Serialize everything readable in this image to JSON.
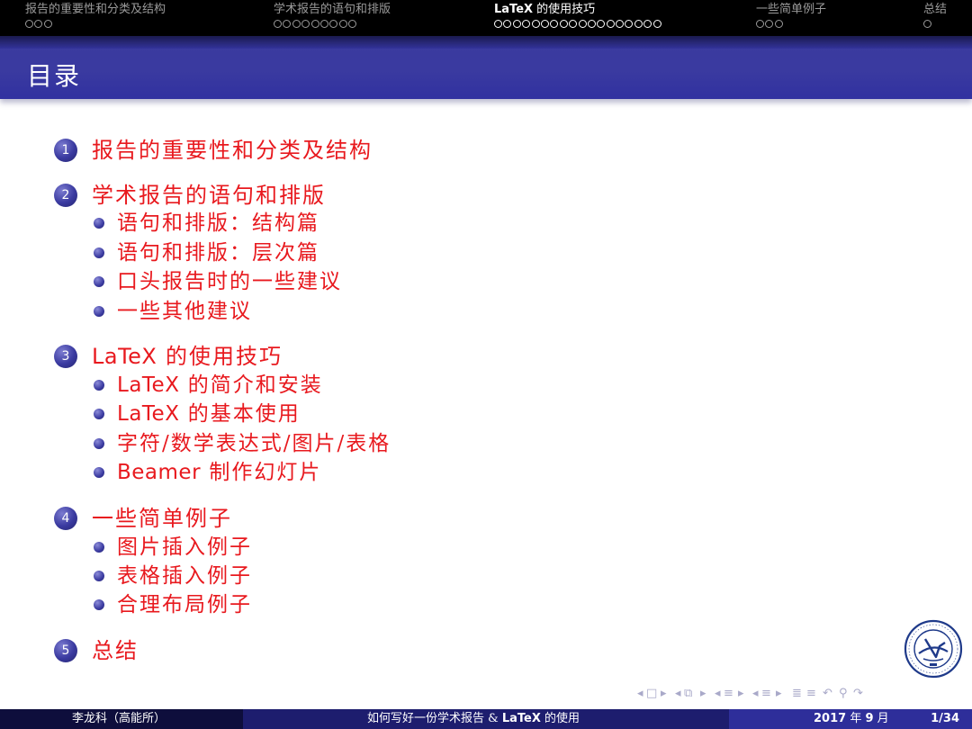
{
  "nav": {
    "sections": [
      {
        "title": "报告的重要性和分类及结构",
        "dots": 3,
        "active": false
      },
      {
        "title": "学术报告的语句和排版",
        "dots": 9,
        "active": false
      },
      {
        "title_latin": "LaTeX",
        "title_rest": " 的使用技巧",
        "dots": 18,
        "active": true
      },
      {
        "title": "一些简单例子",
        "dots": 3,
        "active": false
      },
      {
        "title": "总结",
        "dots": 1,
        "active": false
      }
    ]
  },
  "frame": {
    "title": "目录"
  },
  "toc": {
    "sections": [
      {
        "number": "1",
        "label": "报告的重要性和分类及结构",
        "subs": []
      },
      {
        "number": "2",
        "label": "学术报告的语句和排版",
        "subs": [
          "语句和排版：结构篇",
          "语句和排版：层次篇",
          "口头报告时的一些建议",
          "一些其他建议"
        ]
      },
      {
        "number": "3",
        "label_latin": "LaTeX",
        "label": " 的使用技巧",
        "subs": [
          {
            "latin": "LaTeX",
            "rest": " 的简介和安装"
          },
          {
            "latin": "LaTeX",
            "rest": " 的基本使用"
          },
          {
            "latin": "",
            "rest": "字符/数学表达式/图片/表格"
          },
          {
            "latin": "Beamer",
            "rest": " 制作幻灯片"
          }
        ]
      },
      {
        "number": "4",
        "label": "一些简单例子",
        "subs": [
          "图片插入例子",
          "表格插入例子",
          "合理布局例子"
        ]
      },
      {
        "number": "5",
        "label": "总结",
        "subs": []
      }
    ]
  },
  "footer": {
    "author": "李龙科（高能所）",
    "title_pre": "如何写好一份学术报告 & ",
    "title_latin": "LaTeX",
    "title_post": " 的使用",
    "date_year": "2017",
    "date_mid": " 年 ",
    "date_month": "9",
    "date_end": " 月",
    "page": "1/34"
  },
  "colors": {
    "accent_red": "#e8191e",
    "theme_blue": "#3a3aa0",
    "nav_bg": "#000000"
  },
  "navigation_icons": [
    "slide-prev-icon",
    "slide-next-icon",
    "frame-prev-icon",
    "frame-next-icon",
    "subsection-prev-icon",
    "subsection-next-icon",
    "section-prev-icon",
    "section-next-icon",
    "toc-icon",
    "back-icon",
    "search-icon"
  ]
}
